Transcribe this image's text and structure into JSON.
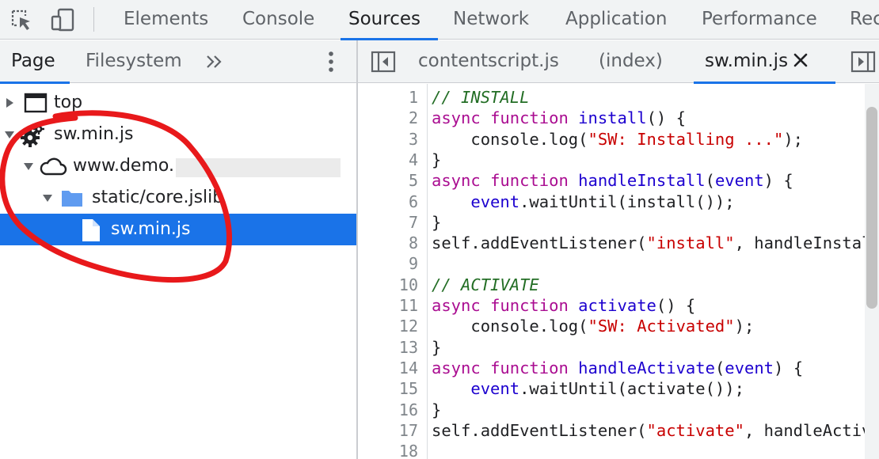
{
  "toolbar": {
    "inspect_icon": "inspect-element-icon",
    "device_icon": "device-toggle-icon",
    "tabs": [
      {
        "label": "Elements"
      },
      {
        "label": "Console"
      },
      {
        "label": "Sources",
        "active": true
      },
      {
        "label": "Network"
      },
      {
        "label": "Application"
      },
      {
        "label": "Performance"
      },
      {
        "label": "Rec"
      }
    ]
  },
  "navigator": {
    "tabs": [
      {
        "label": "Page",
        "active": true
      },
      {
        "label": "Filesystem"
      }
    ],
    "more_icon": "double-chevron-right-icon",
    "menu_icon": "kebab-menu-icon",
    "tree": [
      {
        "label": "top",
        "icon": "window-icon",
        "expanded": false
      },
      {
        "label": "sw.min.js",
        "icon": "gear-icon",
        "expanded": true
      },
      {
        "label": "www.demo.",
        "icon": "cloud-icon",
        "expanded": true
      },
      {
        "label": "static/core.jslib",
        "icon": "folder-icon",
        "expanded": true
      },
      {
        "label": "sw.min.js",
        "icon": "file-icon",
        "selected": true
      }
    ]
  },
  "editor": {
    "tabs": [
      {
        "label": "contentscript.js"
      },
      {
        "label": "(index)"
      },
      {
        "label": "sw.min.js",
        "active": true
      }
    ],
    "close_symbol": "×",
    "lines": [
      {
        "n": "1",
        "tokens": [
          {
            "t": "// INSTALL",
            "c": "cm"
          }
        ]
      },
      {
        "n": "2",
        "tokens": [
          {
            "t": "async",
            "c": "kw"
          },
          {
            "t": " "
          },
          {
            "t": "function",
            "c": "kw"
          },
          {
            "t": " "
          },
          {
            "t": "install",
            "c": "fn"
          },
          {
            "t": "() {"
          }
        ]
      },
      {
        "n": "3",
        "tokens": [
          {
            "t": "    console.log("
          },
          {
            "t": "\"SW: Installing ...\"",
            "c": "st"
          },
          {
            "t": ");"
          }
        ]
      },
      {
        "n": "4",
        "tokens": [
          {
            "t": "}"
          }
        ]
      },
      {
        "n": "5",
        "tokens": [
          {
            "t": "async",
            "c": "kw"
          },
          {
            "t": " "
          },
          {
            "t": "function",
            "c": "kw"
          },
          {
            "t": " "
          },
          {
            "t": "handleInstall",
            "c": "fn"
          },
          {
            "t": "("
          },
          {
            "t": "event",
            "c": "pm"
          },
          {
            "t": ") {"
          }
        ]
      },
      {
        "n": "6",
        "tokens": [
          {
            "t": "    "
          },
          {
            "t": "event",
            "c": "pm"
          },
          {
            "t": ".waitUntil(install());"
          }
        ]
      },
      {
        "n": "7",
        "tokens": [
          {
            "t": "}"
          }
        ]
      },
      {
        "n": "8",
        "tokens": [
          {
            "t": "self.addEventListener("
          },
          {
            "t": "\"install\"",
            "c": "st"
          },
          {
            "t": ", handleInstall);"
          }
        ]
      },
      {
        "n": "9",
        "tokens": []
      },
      {
        "n": "10",
        "tokens": [
          {
            "t": "// ACTIVATE",
            "c": "cm"
          }
        ]
      },
      {
        "n": "11",
        "tokens": [
          {
            "t": "async",
            "c": "kw"
          },
          {
            "t": " "
          },
          {
            "t": "function",
            "c": "kw"
          },
          {
            "t": " "
          },
          {
            "t": "activate",
            "c": "fn"
          },
          {
            "t": "() {"
          }
        ]
      },
      {
        "n": "12",
        "tokens": [
          {
            "t": "    console.log("
          },
          {
            "t": "\"SW: Activated\"",
            "c": "st"
          },
          {
            "t": ");"
          }
        ]
      },
      {
        "n": "13",
        "tokens": [
          {
            "t": "}"
          }
        ]
      },
      {
        "n": "14",
        "tokens": [
          {
            "t": "async",
            "c": "kw"
          },
          {
            "t": " "
          },
          {
            "t": "function",
            "c": "kw"
          },
          {
            "t": " "
          },
          {
            "t": "handleActivate",
            "c": "fn"
          },
          {
            "t": "("
          },
          {
            "t": "event",
            "c": "pm"
          },
          {
            "t": ") {"
          }
        ]
      },
      {
        "n": "15",
        "tokens": [
          {
            "t": "    "
          },
          {
            "t": "event",
            "c": "pm"
          },
          {
            "t": ".waitUntil(activate());"
          }
        ]
      },
      {
        "n": "16",
        "tokens": [
          {
            "t": "}"
          }
        ]
      },
      {
        "n": "17",
        "tokens": [
          {
            "t": "self.addEventListener("
          },
          {
            "t": "\"activate\"",
            "c": "st"
          },
          {
            "t": ", handleActivate);"
          }
        ]
      },
      {
        "n": "18",
        "tokens": []
      }
    ]
  },
  "colors": {
    "accent": "#1a73e8",
    "annotation": "#e8191b",
    "keyword": "#aa0d91",
    "function_name": "#1c00cf",
    "string": "#c80000",
    "comment": "#236e25"
  }
}
